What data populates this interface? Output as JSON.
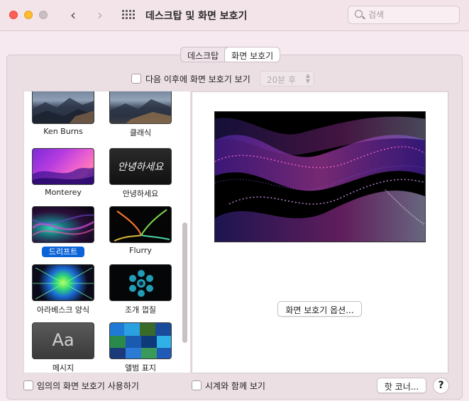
{
  "window": {
    "title": "데스크탑 및 화면 보호기"
  },
  "toolbar": {
    "back_icon": "chevron-left",
    "forward_icon": "chevron-right",
    "grid_icon": "show-all-grid"
  },
  "search": {
    "placeholder": "검색"
  },
  "tabs": [
    {
      "label": "데스크탑",
      "active": false
    },
    {
      "label": "화면 보호기",
      "active": true
    }
  ],
  "start_after": {
    "label": "다음 이후에 화면 보호기 보기",
    "checked": false,
    "value": "20분 후",
    "enabled": false
  },
  "savers": [
    {
      "name": "Ken Burns",
      "selected": false
    },
    {
      "name": "클래식",
      "selected": false
    },
    {
      "name": "Monterey",
      "selected": false
    },
    {
      "name": "안녕하세요",
      "selected": false,
      "thumb_text": "안녕하세요"
    },
    {
      "name": "드리프트",
      "selected": true
    },
    {
      "name": "Flurry",
      "selected": false
    },
    {
      "name": "아라베스크 양식",
      "selected": false
    },
    {
      "name": "조개 껍질",
      "selected": false
    },
    {
      "name": "메시지",
      "selected": false,
      "thumb_text": "Aa"
    },
    {
      "name": "앨범 표지",
      "selected": false
    }
  ],
  "options_button": "화면 보호기 옵션...",
  "random": {
    "label": "임의의 화면 보호기 사용하기",
    "checked": false
  },
  "clock": {
    "label": "시계와 함께 보기",
    "checked": false
  },
  "hot_corners_button": "핫 코너...",
  "help_button": "?",
  "colors": {
    "accent": "#0b63d8",
    "window_bg": "#f6e9ef",
    "panel_bg": "#ebdfe4"
  }
}
